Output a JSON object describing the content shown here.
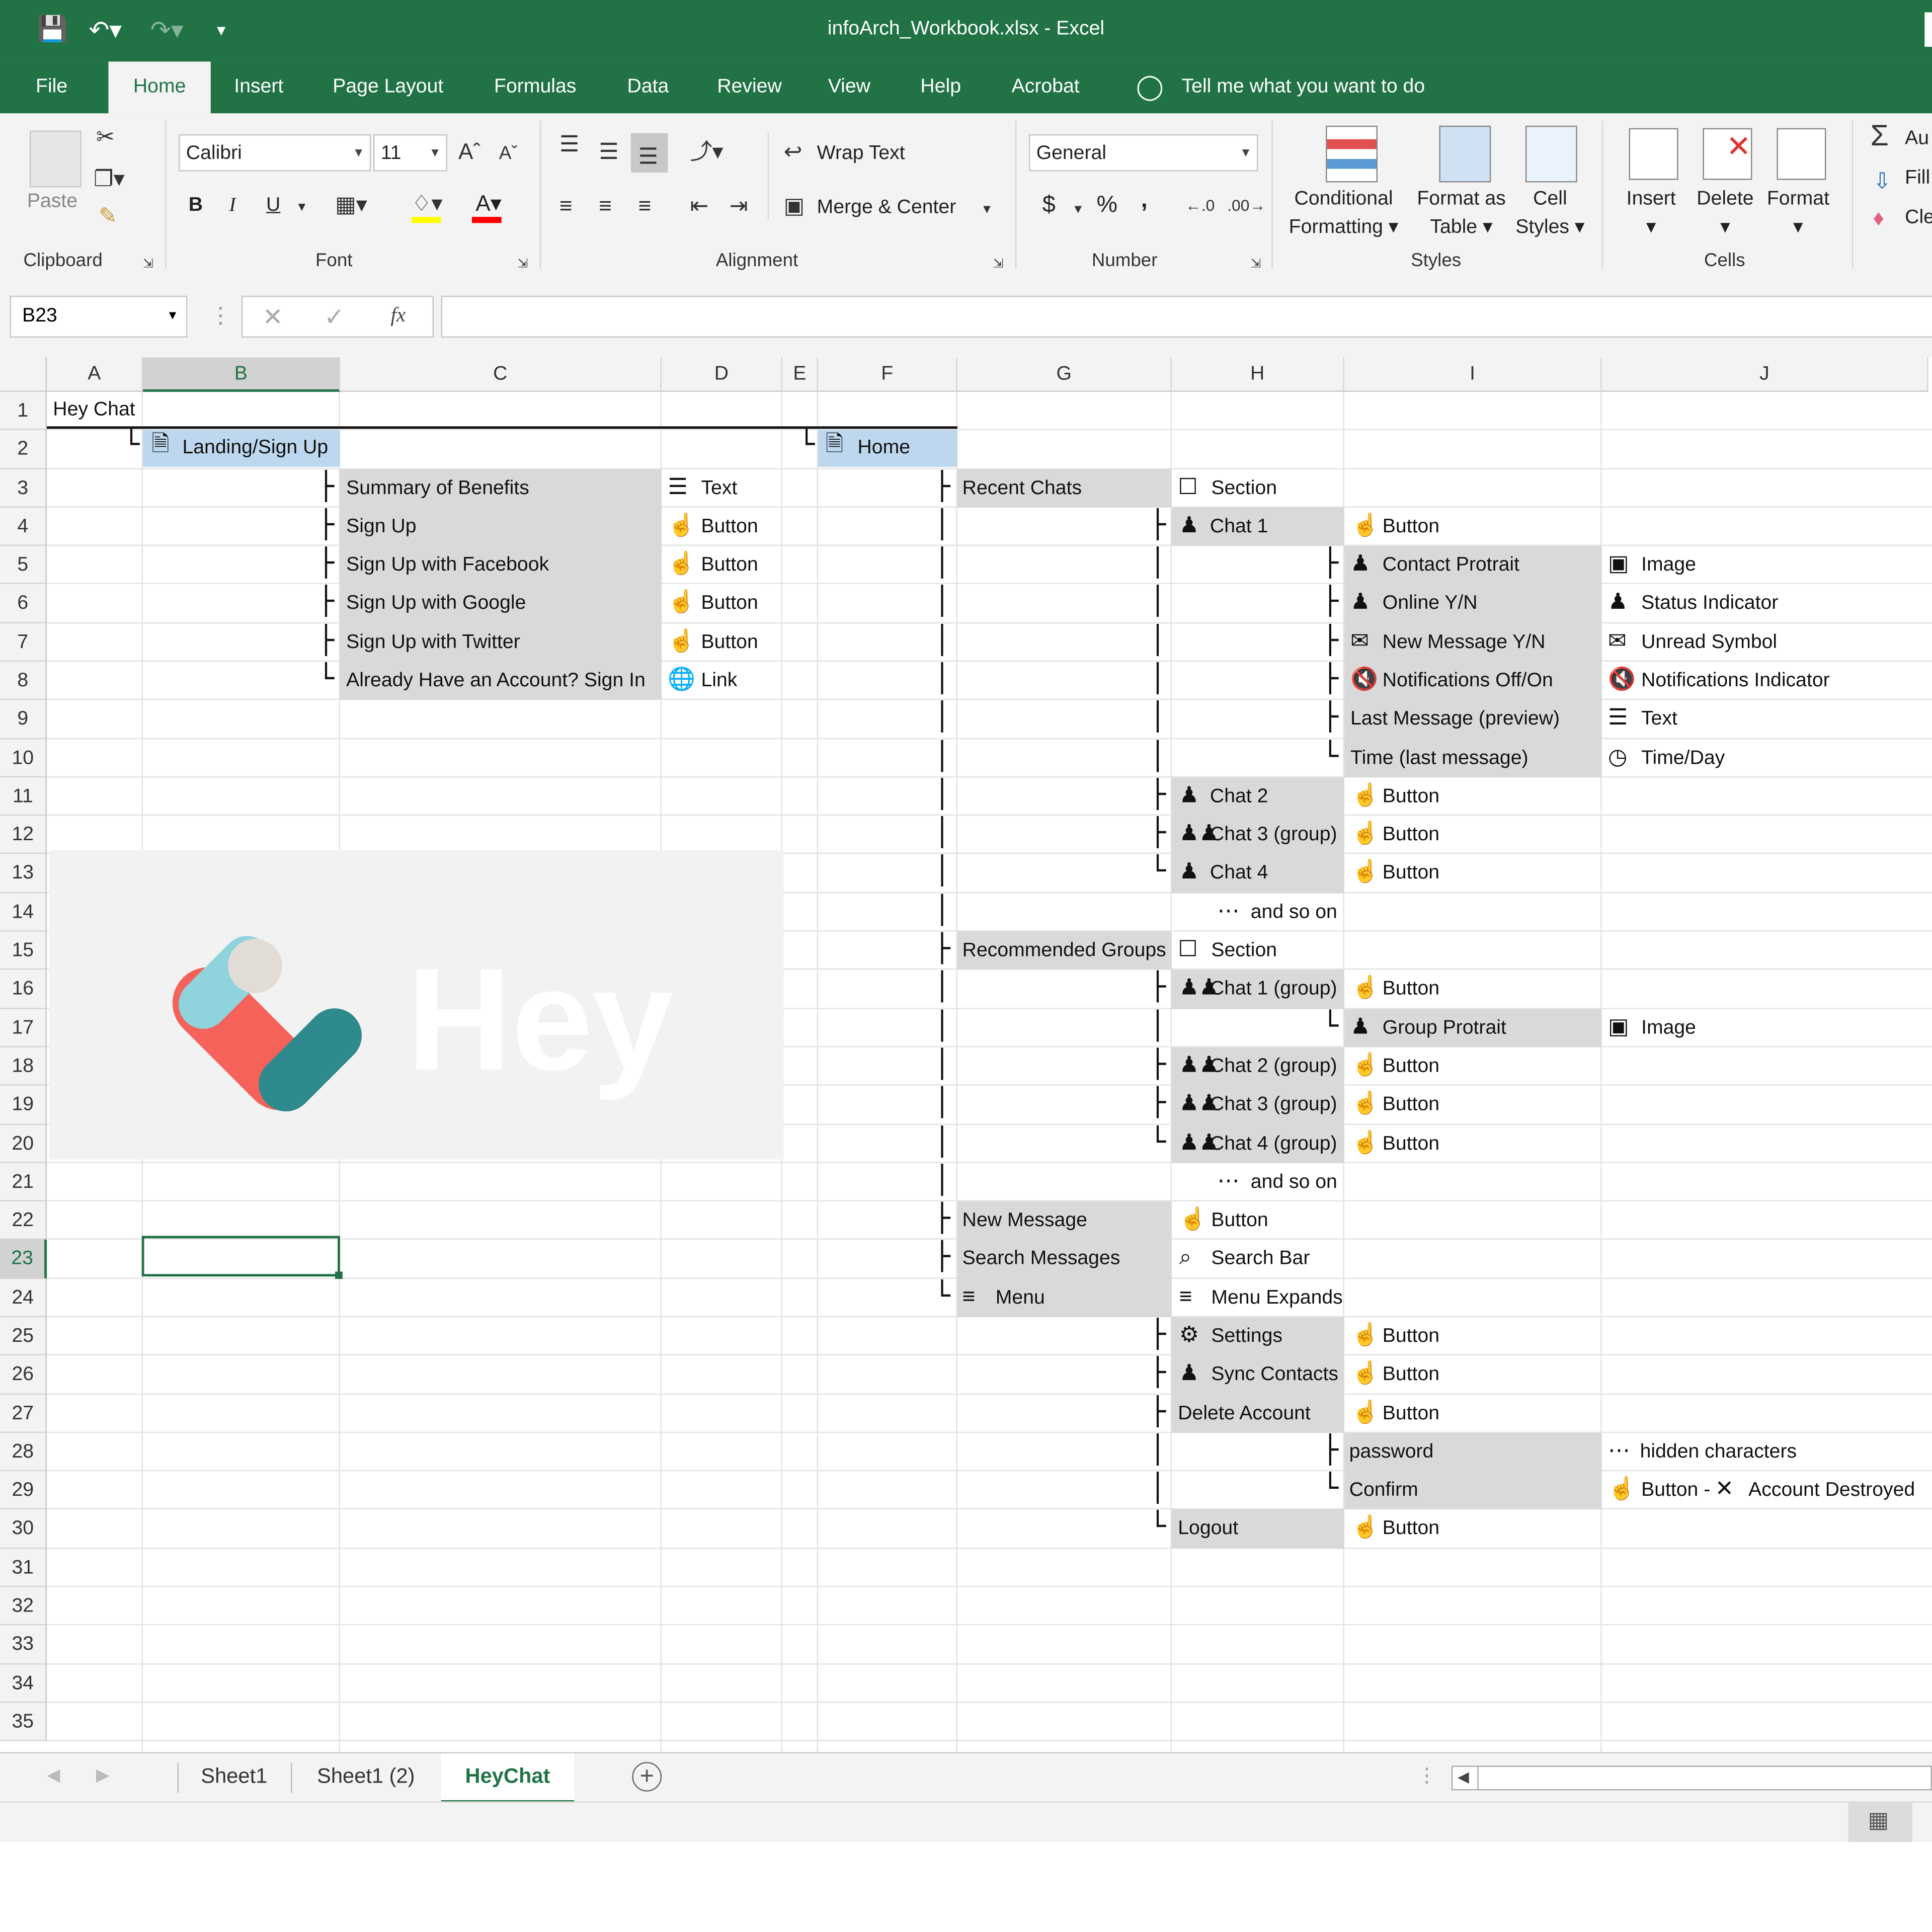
{
  "window": {
    "title": "infoArch_Workbook.xlsx  -  Excel"
  },
  "menu": {
    "tabs": [
      "File",
      "Home",
      "Insert",
      "Page Layout",
      "Formulas",
      "Data",
      "Review",
      "View",
      "Help",
      "Acrobat"
    ],
    "tell_me": "Tell me what you want to do"
  },
  "ribbon": {
    "clipboard": {
      "paste": "Paste",
      "label": "Clipboard"
    },
    "font": {
      "name": "Calibri",
      "size": "11",
      "bold": "B",
      "italic": "I",
      "underline": "U",
      "label": "Font"
    },
    "alignment": {
      "wrap": "Wrap Text",
      "merge": "Merge & Center",
      "label": "Alignment"
    },
    "number": {
      "format": "General",
      "currency": "$",
      "percent": "%",
      "comma": ",",
      "label": "Number"
    },
    "styles": {
      "conditional_1": "Conditional",
      "conditional_2": "Formatting",
      "format_table_1": "Format as",
      "format_table_2": "Table",
      "cell_styles_1": "Cell",
      "cell_styles_2": "Styles",
      "label": "Styles"
    },
    "cells": {
      "insert": "Insert",
      "delete": "Delete",
      "format": "Format",
      "label": "Cells"
    },
    "editing": {
      "autosum": "Au",
      "fill": "Fill",
      "clear": "Cle"
    }
  },
  "formula_bar": {
    "name_box": "B23",
    "fx": "fx",
    "value": ""
  },
  "columns": [
    "A",
    "B",
    "C",
    "D",
    "E",
    "F",
    "G",
    "H",
    "I",
    "J"
  ],
  "rows": [
    "1",
    "2",
    "3",
    "4",
    "5",
    "6",
    "7",
    "8",
    "9",
    "10",
    "11",
    "12",
    "13",
    "14",
    "15",
    "16",
    "17",
    "18",
    "19",
    "20",
    "21",
    "22",
    "23",
    "24",
    "25",
    "26",
    "27",
    "28",
    "29",
    "30",
    "31",
    "32",
    "33",
    "34",
    "35"
  ],
  "selected_row": "23",
  "logo_text": "Hey",
  "sheet": {
    "title": "Hey Chat",
    "landing": "Landing/Sign Up",
    "landing_items": [
      "Summary of Benefits",
      "Sign Up",
      "Sign Up with Facebook",
      "Sign Up with Google",
      "Sign Up with Twitter",
      "Already Have an Account? Sign In"
    ],
    "landing_types": [
      "Text",
      "Button",
      "Button",
      "Button",
      "Button",
      "Link"
    ],
    "home": "Home",
    "g": {
      "recent": "Recent Chats",
      "recommended": "Recommended Groups",
      "new_message": "New Message",
      "search": "Search Messages",
      "menu": "Menu"
    },
    "h": {
      "section1": "Section",
      "chat1": "Chat 1",
      "chat2": "Chat 2",
      "chat3": "Chat 3 (group)",
      "chat4": "Chat 4",
      "more1": "and so on",
      "section2": "Section",
      "gchat1": "Chat 1 (group)",
      "gchat2": "Chat 2 (group)",
      "gchat3": "Chat 3 (group)",
      "gchat4": "Chat 4 (group)",
      "more2": "and so on",
      "button": "Button",
      "searchbar": "Search Bar",
      "menu_expands": "Menu Expands",
      "settings": "Settings",
      "sync": "Sync Contacts",
      "delete_account": "Delete Account",
      "logout": "Logout"
    },
    "i_button": "Button",
    "chat1_children": [
      "Contact Protrait",
      "Online Y/N",
      "New Message Y/N",
      "Notifications Off/On",
      "Last Message (preview)",
      "Time (last message)"
    ],
    "chat1_types": [
      "Image",
      "Status Indicator",
      "Unread Symbol",
      "Notifications Indicator",
      "Text",
      "Time/Day"
    ],
    "group_protrait": "Group Protrait",
    "group_protrait_type": "Image",
    "password": "password",
    "confirm": "Confirm",
    "hidden": "hidden characters",
    "confirm_type": "Button -",
    "destroyed": "Account Destroyed"
  },
  "sheet_tabs": [
    "Sheet1",
    "Sheet1 (2)",
    "HeyChat"
  ],
  "colors": {
    "excel_green": "#217346",
    "cell_fill": "#d9d9d9",
    "blue_fill": "#bdd7ee",
    "logo_coral": "#f4625a",
    "logo_teal": "#2e8a8c",
    "logo_cyan": "#8fd3dc"
  }
}
